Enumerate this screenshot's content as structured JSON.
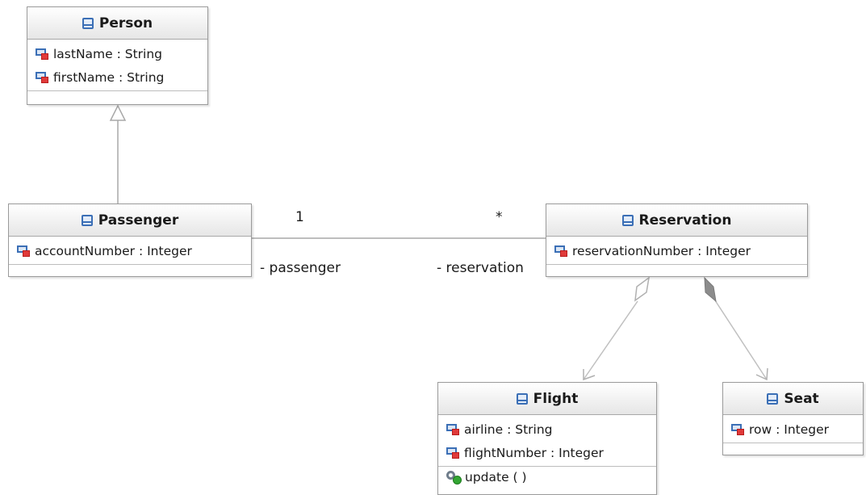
{
  "classes": {
    "person": {
      "name": "Person",
      "attributes": [
        {
          "name": "lastName",
          "type": "String"
        },
        {
          "name": "firstName",
          "type": "String"
        }
      ]
    },
    "passenger": {
      "name": "Passenger",
      "attributes": [
        {
          "name": "accountNumber",
          "type": "Integer"
        }
      ]
    },
    "reservation": {
      "name": "Reservation",
      "attributes": [
        {
          "name": "reservationNumber",
          "type": "Integer"
        }
      ]
    },
    "flight": {
      "name": "Flight",
      "attributes": [
        {
          "name": "airline",
          "type": "String"
        },
        {
          "name": "flightNumber",
          "type": "Integer"
        }
      ],
      "operations": [
        {
          "signature": "update ( )"
        }
      ]
    },
    "seat": {
      "name": "Seat",
      "attributes": [
        {
          "name": "row",
          "type": "Integer"
        }
      ]
    }
  },
  "association": {
    "passenger_multiplicity": "1",
    "reservation_multiplicity": "*",
    "passenger_role": "- passenger",
    "reservation_role": "- reservation"
  },
  "icons": {
    "class": "class-icon",
    "attribute": "attribute-icon",
    "operation": "operation-icon"
  },
  "colors": {
    "class_icon": "#3b6fb6",
    "attribute_marker": "#e03a3a",
    "operation_marker": "#33a633",
    "edge": "#a8a8a8",
    "composition_fill": "#8c8c8c"
  }
}
